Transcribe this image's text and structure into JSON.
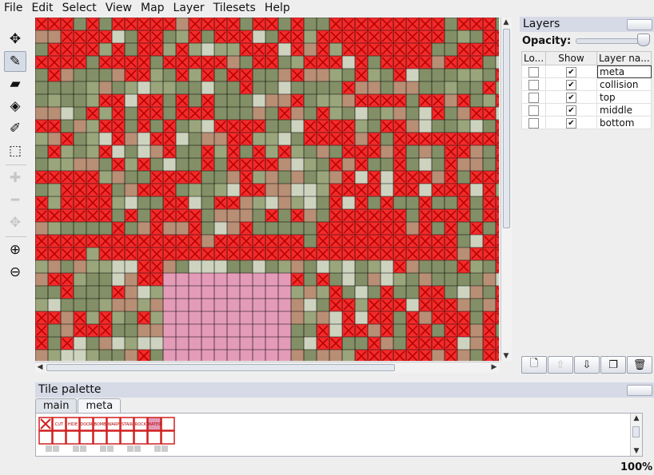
{
  "menu": [
    "File",
    "Edit",
    "Select",
    "View",
    "Map",
    "Layer",
    "Tilesets",
    "Help"
  ],
  "tools": [
    {
      "name": "move-icon",
      "glyph": "✥",
      "active": false,
      "enabled": true
    },
    {
      "name": "stamp-brush-icon",
      "glyph": "✎",
      "active": true,
      "enabled": true
    },
    {
      "name": "eraser-icon",
      "glyph": "▰",
      "active": false,
      "enabled": true
    },
    {
      "name": "bucket-fill-icon",
      "glyph": "◈",
      "active": false,
      "enabled": true
    },
    {
      "name": "eyedropper-icon",
      "glyph": "✐",
      "active": false,
      "enabled": true
    },
    {
      "name": "rect-select-icon",
      "glyph": "⬚",
      "active": false,
      "enabled": true
    },
    {
      "name": "zoom-add-icon",
      "glyph": "✚",
      "active": false,
      "enabled": false
    },
    {
      "name": "zoom-remove-icon",
      "glyph": "━",
      "active": false,
      "enabled": false
    },
    {
      "name": "pan-icon",
      "glyph": "✥",
      "active": false,
      "enabled": false
    },
    {
      "name": "zoom-in-icon",
      "glyph": "⊕",
      "active": false,
      "enabled": true
    },
    {
      "name": "zoom-out-icon",
      "glyph": "⊖",
      "active": false,
      "enabled": true
    }
  ],
  "layers_panel": {
    "title": "Layers",
    "opacity_label": "Opacity:",
    "opacity": 1.0,
    "columns": [
      "Lo...",
      "Show",
      "Layer na..."
    ],
    "layers": [
      {
        "name": "meta",
        "locked": false,
        "visible": true,
        "editing": true
      },
      {
        "name": "collision",
        "locked": false,
        "visible": true,
        "editing": false
      },
      {
        "name": "top",
        "locked": false,
        "visible": true,
        "editing": false
      },
      {
        "name": "middle",
        "locked": false,
        "visible": true,
        "editing": false
      },
      {
        "name": "bottom",
        "locked": false,
        "visible": true,
        "editing": false
      }
    ],
    "buttons": [
      "new-layer-icon",
      "move-layer-up-icon",
      "move-layer-down-icon",
      "duplicate-layer-icon",
      "delete-layer-icon"
    ]
  },
  "palette": {
    "title": "Tile palette",
    "tabs": [
      "main",
      "meta"
    ],
    "active_tab": "meta",
    "tiles": [
      "",
      "CUT",
      "HIDE",
      "DOOR",
      "BOMB",
      "WARP",
      "STAIR",
      "ROCK",
      "WATER",
      ""
    ]
  },
  "zoom": "100%",
  "colors": {
    "red": "#f22b2b",
    "red_dark": "#b30000",
    "olive": "#838f66",
    "olive_light": "#9aa57b",
    "tan": "#b88e75",
    "pale": "#cdd3bf",
    "water_pink": "#e39bb8",
    "grid": "#000000"
  }
}
